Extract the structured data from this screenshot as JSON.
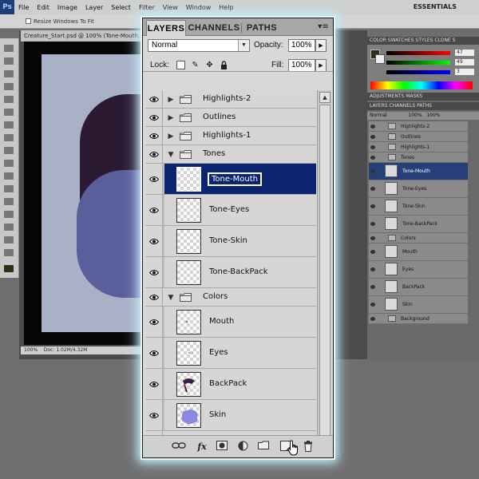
{
  "app": {
    "logo": "Ps",
    "menus": [
      "File",
      "Edit",
      "Image",
      "Layer",
      "Select",
      "Filter",
      "View",
      "Window",
      "Help"
    ],
    "workspace": "ESSENTIALS",
    "options_checkbox": "Resize Windows To Fit",
    "document_tab": "Creature_Start.psd @ 100% (Tone-Mouth, R...",
    "zoom": "100%",
    "doc_info": "Doc: 1.02M/4.32M"
  },
  "mini_panels": {
    "color_tabs": "COLOR  SWATCHES STYLES  CLONE S",
    "adjust_tabs": "ADJUSTMENTS   MASKS",
    "layers_tabs": "LAYERS  CHANNELS  PATHS",
    "rgb": [
      "47",
      "49",
      "3"
    ],
    "blend": "Normal",
    "opacity": "100%",
    "fill": "100%",
    "layers": [
      {
        "name": "Highlights-2",
        "type": "group"
      },
      {
        "name": "Outlines",
        "type": "group"
      },
      {
        "name": "Highlights-1",
        "type": "group"
      },
      {
        "name": "Tones",
        "type": "group"
      },
      {
        "name": "Tone-Mouth",
        "type": "layer",
        "selected": true
      },
      {
        "name": "Tone-Eyes",
        "type": "layer"
      },
      {
        "name": "Tone-Skin",
        "type": "layer"
      },
      {
        "name": "Tone-BackPack",
        "type": "layer"
      },
      {
        "name": "Colors",
        "type": "group"
      },
      {
        "name": "Mouth",
        "type": "layer"
      },
      {
        "name": "Eyes",
        "type": "layer"
      },
      {
        "name": "BackPack",
        "type": "layer"
      },
      {
        "name": "Skin",
        "type": "layer"
      },
      {
        "name": "Background",
        "type": "group"
      }
    ]
  },
  "panel": {
    "tabs": [
      "LAYERS",
      "CHANNELS",
      "PATHS"
    ],
    "active_tab": "LAYERS",
    "menu_icon": "panel-menu-icon",
    "blend_mode": "Normal",
    "opacity_label": "Opacity:",
    "opacity_value": "100%",
    "lock_label": "Lock:",
    "fill_label": "Fill:",
    "fill_value": "100%",
    "lock_icons": [
      "lock-transparent-icon",
      "lock-image-icon",
      "lock-position-icon",
      "lock-all-icon"
    ],
    "layers": [
      {
        "name": "Highlights-2",
        "type": "group",
        "expanded": false
      },
      {
        "name": "Outlines",
        "type": "group",
        "expanded": false
      },
      {
        "name": "Highlights-1",
        "type": "group",
        "expanded": false
      },
      {
        "name": "Tones",
        "type": "group",
        "expanded": true
      },
      {
        "name": "Tone-Mouth",
        "type": "layer",
        "selected": true,
        "editing": true
      },
      {
        "name": "Tone-Eyes",
        "type": "layer"
      },
      {
        "name": "Tone-Skin",
        "type": "layer"
      },
      {
        "name": "Tone-BackPack",
        "type": "layer"
      },
      {
        "name": "Colors",
        "type": "group",
        "expanded": true
      },
      {
        "name": "Mouth",
        "type": "layer"
      },
      {
        "name": "Eyes",
        "type": "layer"
      },
      {
        "name": "BackPack",
        "type": "layer"
      },
      {
        "name": "Skin",
        "type": "layer"
      },
      {
        "name": "Background",
        "type": "group",
        "expanded": false
      }
    ],
    "bottom_buttons": [
      "link-layers-icon",
      "fx-icon",
      "add-mask-icon",
      "adjustment-layer-icon",
      "new-group-icon",
      "new-layer-icon",
      "trash-icon"
    ],
    "fx_label": "fx",
    "colors": {
      "selection": "#0a2472",
      "glow": "#bfe9f6",
      "panel_bg": "#d8d8d8",
      "skin_thumb": "#8c88e0",
      "backpack_thumb": "#3a1f4a"
    }
  }
}
